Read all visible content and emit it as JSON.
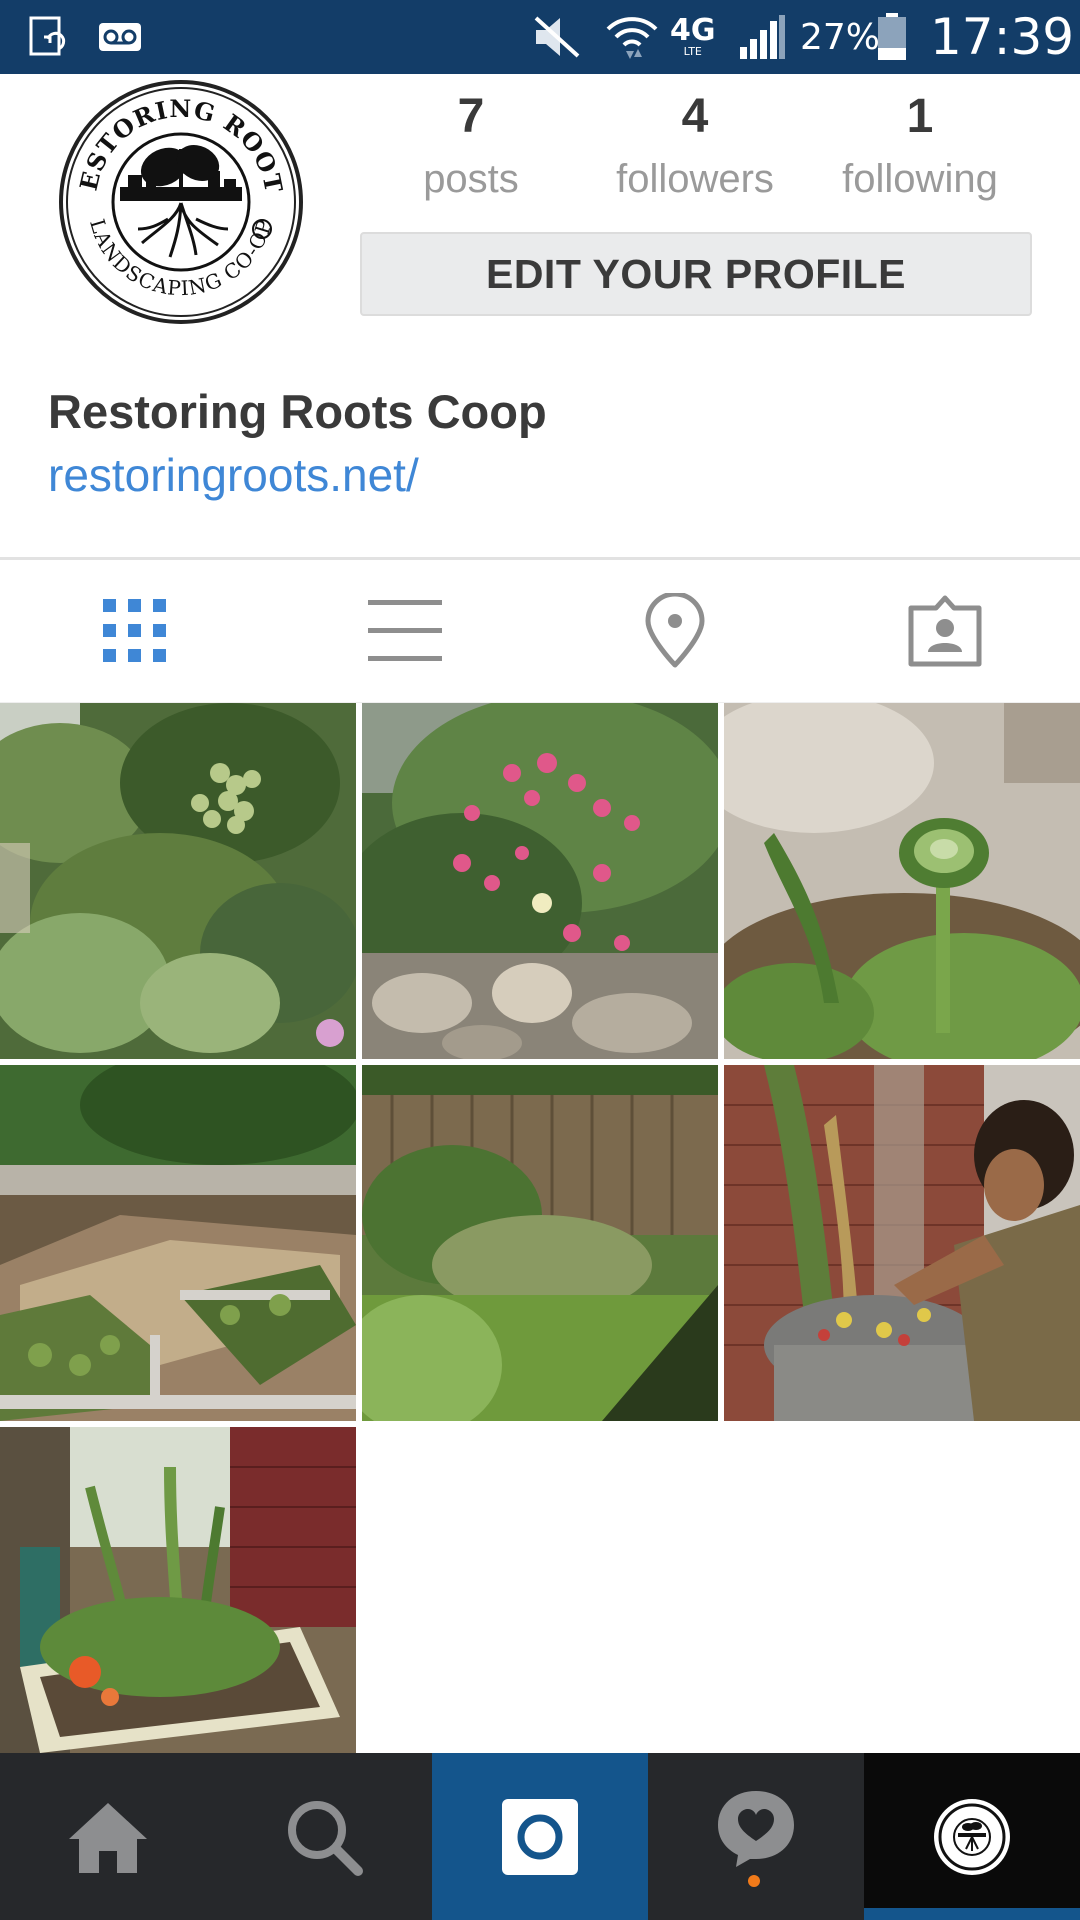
{
  "status_bar": {
    "network": "4G",
    "network_sub": "LTE",
    "battery": "27%",
    "time": "17:39"
  },
  "profile": {
    "posts_count": "7",
    "posts_label": "posts",
    "followers_count": "4",
    "followers_label": "followers",
    "following_count": "1",
    "following_label": "following",
    "edit_button": "EDIT YOUR PROFILE",
    "name": "Restoring Roots Coop",
    "website": "restoringroots.net/",
    "logo_text_top": "RESTORING ROOTS",
    "logo_text_bottom": "LANDSCAPING CO-OP"
  },
  "view_tabs": [
    {
      "name": "grid-view",
      "icon": "grid-icon",
      "active": true
    },
    {
      "name": "list-view",
      "icon": "list-icon",
      "active": false
    },
    {
      "name": "places-view",
      "icon": "location-pin-icon",
      "active": false
    },
    {
      "name": "tagged-view",
      "icon": "tagged-person-icon",
      "active": false
    }
  ],
  "posts": [
    {
      "subject": "grape vines"
    },
    {
      "subject": "pink yarrow flowers"
    },
    {
      "subject": "flower bud"
    },
    {
      "subject": "raised garden beds"
    },
    {
      "subject": "fenced yard garden"
    },
    {
      "subject": "person planting barrel"
    },
    {
      "subject": "planter box with nasturtium"
    }
  ],
  "bottom_nav": [
    {
      "name": "home",
      "icon": "home-icon"
    },
    {
      "name": "search",
      "icon": "search-icon"
    },
    {
      "name": "camera",
      "icon": "camera-icon"
    },
    {
      "name": "activity",
      "icon": "heart-bubble-icon"
    },
    {
      "name": "profile",
      "icon": "profile-avatar-icon"
    }
  ],
  "colors": {
    "status_bar": "#133d68",
    "accent_blue": "#3f87d6",
    "nav_bg": "#26282b",
    "camera_tab": "#14558c",
    "profile_tab": "#0a0a0a",
    "notification_dot": "#f07a1a"
  }
}
